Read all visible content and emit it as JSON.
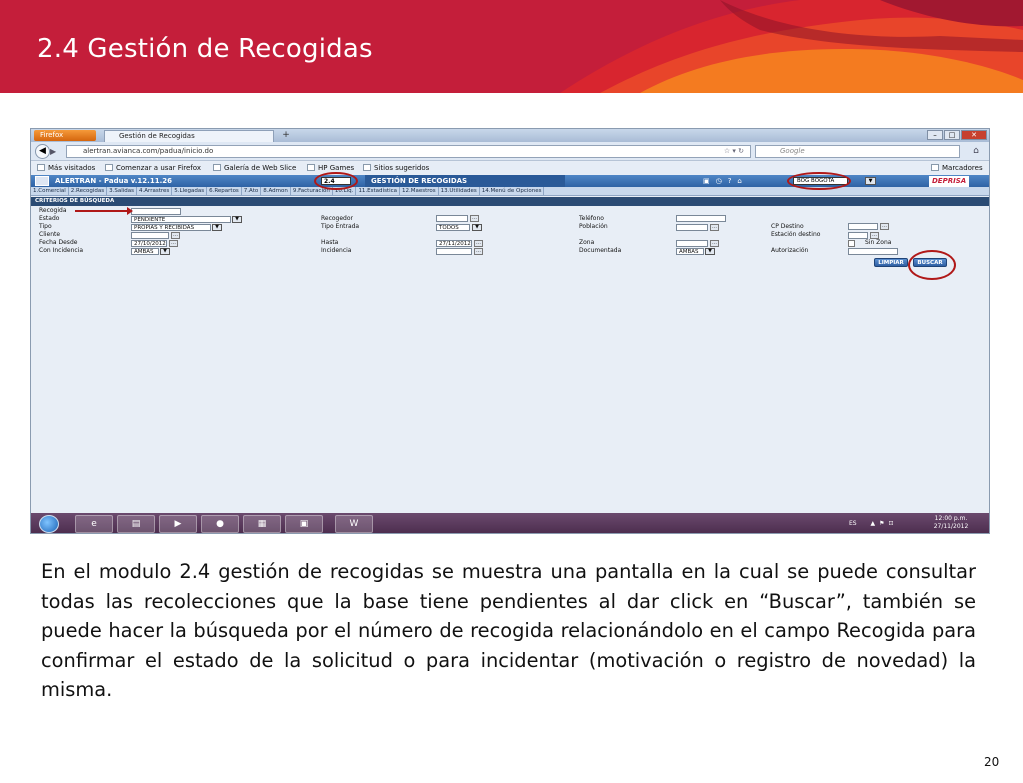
{
  "slide": {
    "title": "2.4 Gestión de Recogidas",
    "page_number": "20",
    "description": "En el modulo 2.4 gestión de recogidas se muestra una pantalla en la cual se puede consultar todas las recolecciones que la base tiene pendientes al dar click en “Buscar”, también se puede hacer la búsqueda por el número de recogida relacionándolo en el campo Recogida para confirmar el estado de la solicitud o para incidentar (motivación o registro de novedad) la misma.",
    "colors": {
      "banner_red": "#c41e3a",
      "banner_orange": "#f47b20",
      "annotation_red": "#b01818"
    }
  },
  "browser": {
    "menu_button": "Firefox",
    "tab_title": "Gestión de Recogidas",
    "new_tab": "+",
    "url": "alertran.avianca.com/padua/inicio.do",
    "search_placeholder": "Google",
    "bookmarks": [
      "Más visitados",
      "Comenzar a usar Firefox",
      "Galería de Web Slice",
      "HP Games",
      "Sitios sugeridos"
    ],
    "bookmarks_menu": "Marcadores"
  },
  "app": {
    "name": "ALERTRAN - Padua  v.12.11.26",
    "module_code": "2.4",
    "module_title": "GESTIÓN DE RECOGIDAS",
    "branch": "BOG BOGOTA",
    "brand": "DEPRISA",
    "menu": [
      "1.Comercial",
      "2.Recogidas",
      "3.Salidas",
      "4.Arrastres",
      "5.Llegadas",
      "6.Repartos",
      "7.Ato",
      "8.Admon",
      "9.Facturación",
      "10.Liq.",
      "11.Estadística",
      "12.Maestros",
      "13.Utilidades",
      "14.Menú de Opciones"
    ],
    "criteria_title": "CRITERIOS DE BÚSQUEDA",
    "form": {
      "recogida": {
        "label": "Recogida",
        "value": ""
      },
      "estado": {
        "label": "Estado",
        "value": "PENDIENTE"
      },
      "tipo": {
        "label": "Tipo",
        "value": "PROPIAS Y RECIBIDAS"
      },
      "cliente": {
        "label": "Cliente",
        "value": ""
      },
      "fecha_desde": {
        "label": "Fecha Desde",
        "value": "27/10/2012"
      },
      "con_incidencia": {
        "label": "Con Incidencia",
        "value": "AMBAS"
      },
      "recogedor": {
        "label": "Recogedor",
        "value": ""
      },
      "tipo_entrada": {
        "label": "Tipo Entrada",
        "value": "TODOS"
      },
      "hasta": {
        "label": "Hasta",
        "value": "27/11/2012"
      },
      "incidencia": {
        "label": "Incidencia",
        "value": ""
      },
      "telefono": {
        "label": "Teléfono",
        "value": ""
      },
      "poblacion": {
        "label": "Población",
        "value": ""
      },
      "zona": {
        "label": "Zona",
        "value": ""
      },
      "documentada": {
        "label": "Documentada",
        "value": "AMBAS"
      },
      "cp_destino": {
        "label": "CP Destino",
        "value": ""
      },
      "estacion_destino": {
        "label": "Estación destino",
        "value": ""
      },
      "sin_zona": {
        "label": "Sin Zona"
      },
      "autorizacion": {
        "label": "Autorización",
        "value": ""
      }
    },
    "buttons": {
      "limpiar": "LIMPIAR",
      "buscar": "BUSCAR"
    }
  },
  "taskbar": {
    "language": "ES",
    "time": "12:00 p.m.",
    "date": "27/11/2012"
  }
}
